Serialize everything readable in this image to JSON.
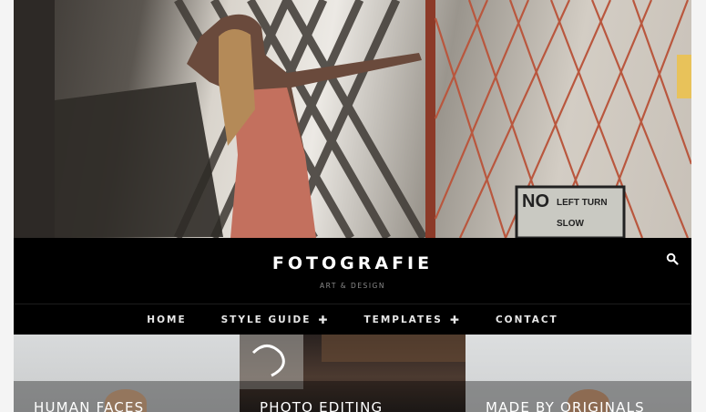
{
  "site": {
    "title": "FOTOGRAFIE",
    "tagline": "ART & DESIGN"
  },
  "header": {
    "search_icon": "search-icon"
  },
  "nav": {
    "items": [
      {
        "label": "HOME",
        "has_submenu": false
      },
      {
        "label": "STYLE GUIDE",
        "has_submenu": true
      },
      {
        "label": "TEMPLATES",
        "has_submenu": true
      },
      {
        "label": "CONTACT",
        "has_submenu": false
      }
    ],
    "submenu_glyph": "✚"
  },
  "hero": {
    "sign_line1": "NO",
    "sign_line2": "LEFT TURN",
    "sign_line3": "SLOW"
  },
  "cards": [
    {
      "title": "HUMAN FACES"
    },
    {
      "title": "PHOTO EDITING"
    },
    {
      "title": "MADE BY ORIGINALS"
    }
  ],
  "colors": {
    "header_bg": "#000000",
    "nav_text": "#e8e8e8",
    "tagline_text": "#8a8a8a",
    "page_bg": "#f4f4f4"
  }
}
